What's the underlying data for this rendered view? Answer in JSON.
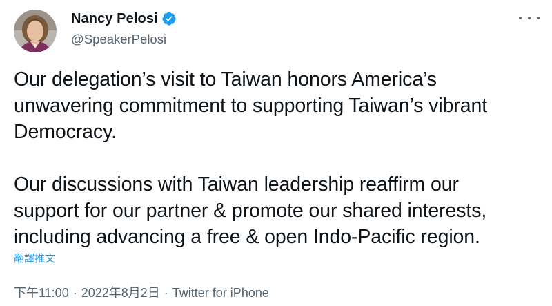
{
  "author": {
    "name": "Nancy Pelosi",
    "handle": "@SpeakerPelosi",
    "verified_icon": "verified-badge-icon",
    "avatar_icon": "profile-photo"
  },
  "more_menu_icon": "more-options-icon",
  "tweet": {
    "paragraph1": [
      "Our delegation’s visit to Taiwan honors America’s",
      "unwavering commitment to supporting Taiwan’s vibrant",
      "Democracy."
    ],
    "paragraph2": [
      "Our discussions with Taiwan leadership reaffirm our",
      "support for our partner & promote our shared interests,",
      "including advancing a free & open Indo-Pacific region."
    ]
  },
  "translate_label": "翻譯推文",
  "meta": {
    "time": "下午11:00",
    "separator": "·",
    "date": "2022年8月2日",
    "source": "Twitter for iPhone"
  },
  "colors": {
    "text": "#0f1419",
    "secondary": "#536471",
    "accent": "#1d9bf0"
  }
}
